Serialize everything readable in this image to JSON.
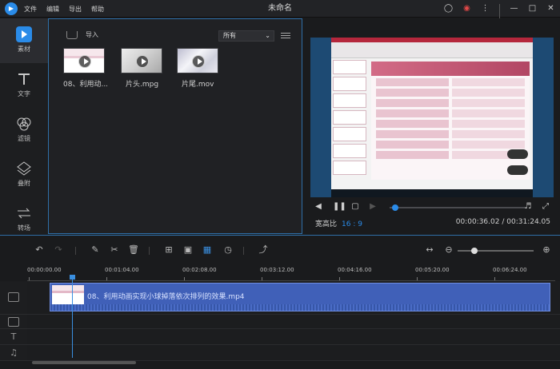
{
  "menu": {
    "file": "文件",
    "edit": "编辑",
    "export": "导出",
    "help": "帮助"
  },
  "window": {
    "title": "未命名"
  },
  "tools": [
    {
      "label": "素材",
      "icon": "media-icon",
      "active": true
    },
    {
      "label": "文字",
      "icon": "text-icon"
    },
    {
      "label": "滤镜",
      "icon": "filter-icon"
    },
    {
      "label": "叠附",
      "icon": "overlay-icon"
    },
    {
      "label": "转场",
      "icon": "transition-icon"
    }
  ],
  "library": {
    "import_label": "导入",
    "filter_value": "所有",
    "items": [
      {
        "name": "08、利用动..."
      },
      {
        "name": "片头.mpg"
      },
      {
        "name": "片尾.mov"
      }
    ]
  },
  "preview": {
    "ratio_label": "宽高比",
    "ratio_value": "16 : 9",
    "current_time": "00:00:36.02",
    "total_time": "00:31:24.05",
    "time_separator": "/",
    "progress_fraction": 0.02
  },
  "timeline": {
    "ruler": [
      "00:00:00.00",
      "00:01:04.00",
      "00:02:08.00",
      "00:03:12.00",
      "00:04:16.00",
      "00:05:20.00",
      "00:06:24.00"
    ],
    "clip_name": "08、利用动画实现小球掉落依次排列的效果.mp4",
    "zoom_fraction": 0.2
  },
  "colors": {
    "accent": "#2a8be8",
    "clip": "#4060b8",
    "panel_border": "#2f6fa8"
  }
}
